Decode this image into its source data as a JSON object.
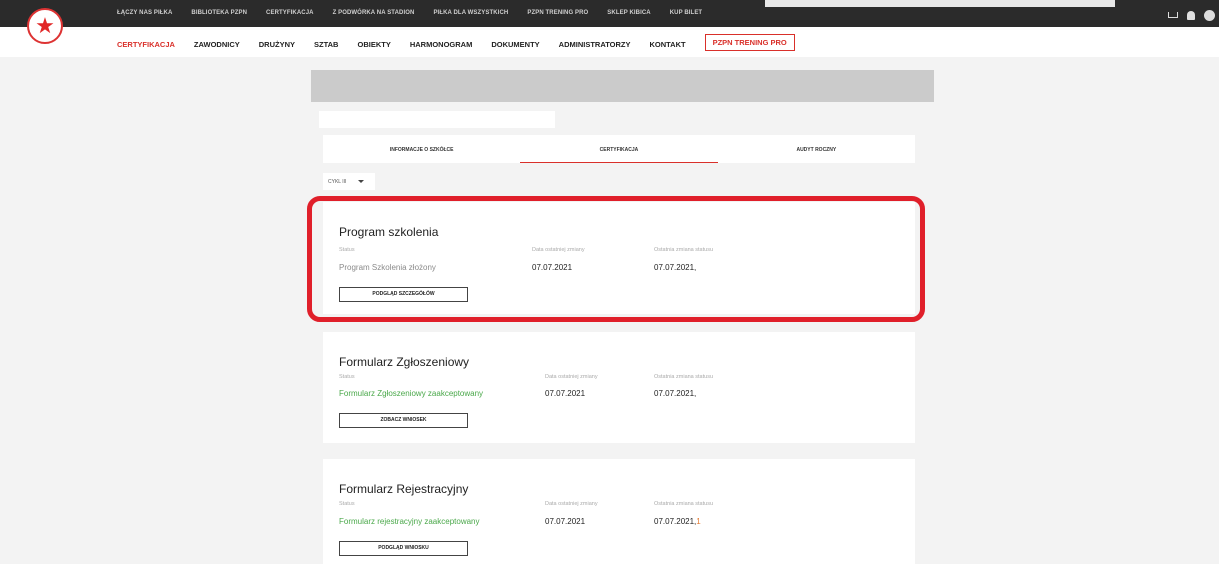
{
  "topbar": {
    "links": [
      "ŁĄCZY NAS PIŁKA",
      "BIBLIOTEKA PZPN",
      "CERTYFIKACJA",
      "Z PODWÓRKA NA STADION",
      "PIŁKA DLA WSZYSTKICH",
      "PZPN TRENING PRO",
      "SKLEP KIBICA",
      "KUP BILET"
    ],
    "icons": [
      "cart-icon",
      "bell-icon",
      "user-icon"
    ]
  },
  "mainnav": {
    "items": [
      "CERTYFIKACJA",
      "ZAWODNICY",
      "DRUŻYNY",
      "SZTAB",
      "OBIEKTY",
      "HARMONOGRAM",
      "DOKUMENTY",
      "ADMINISTRATORZY",
      "KONTAKT"
    ],
    "boxed_item": "PZPN TRENING PRO",
    "active_index": 0
  },
  "tabs": [
    "INFORMACJE O SZKÓŁCE",
    "CERTYFIKACJA",
    "AUDYT ROCZNY"
  ],
  "active_tab": 1,
  "cycle_select": {
    "value": "CYKL III"
  },
  "cards": [
    {
      "title": "Program szkolenia",
      "status_label": "Status",
      "status_value": "Program Szkolenia złożony",
      "date_label": "Data ostatniej zmiany",
      "date_value": "07.07.2021",
      "status_change_label": "Ostatnia zmiana statusu",
      "status_change_value": "07.07.2021,",
      "button_label": "PODGLĄD SZCZEGÓŁÓW"
    },
    {
      "title": "Formularz Zgłoszeniowy",
      "status_label": "Status",
      "status_value": "Formularz Zgłoszeniowy zaakceptowany",
      "date_label": "Data ostatniej zmiany",
      "date_value": "07.07.2021",
      "status_change_label": "Ostatnia zmiana statusu",
      "status_change_value": "07.07.2021,",
      "button_label": "ZOBACZ WNIOSEK"
    },
    {
      "title": "Formularz Rejestracyjny",
      "status_label": "Status",
      "status_value": "Formularz rejestracyjny zaakceptowany",
      "date_label": "Data ostatniej zmiany",
      "date_value": "07.07.2021",
      "status_change_label": "Ostatnia zmiana statusu",
      "status_change_value": "07.07.2021,",
      "status_change_mark": "1",
      "button_label": "PODGLĄD WNIOSKU"
    }
  ],
  "colors": {
    "accent_red": "#d9302a",
    "highlight_red": "#e01f2a",
    "status_green": "#4aa84a",
    "topbar": "#2b2b2b"
  }
}
